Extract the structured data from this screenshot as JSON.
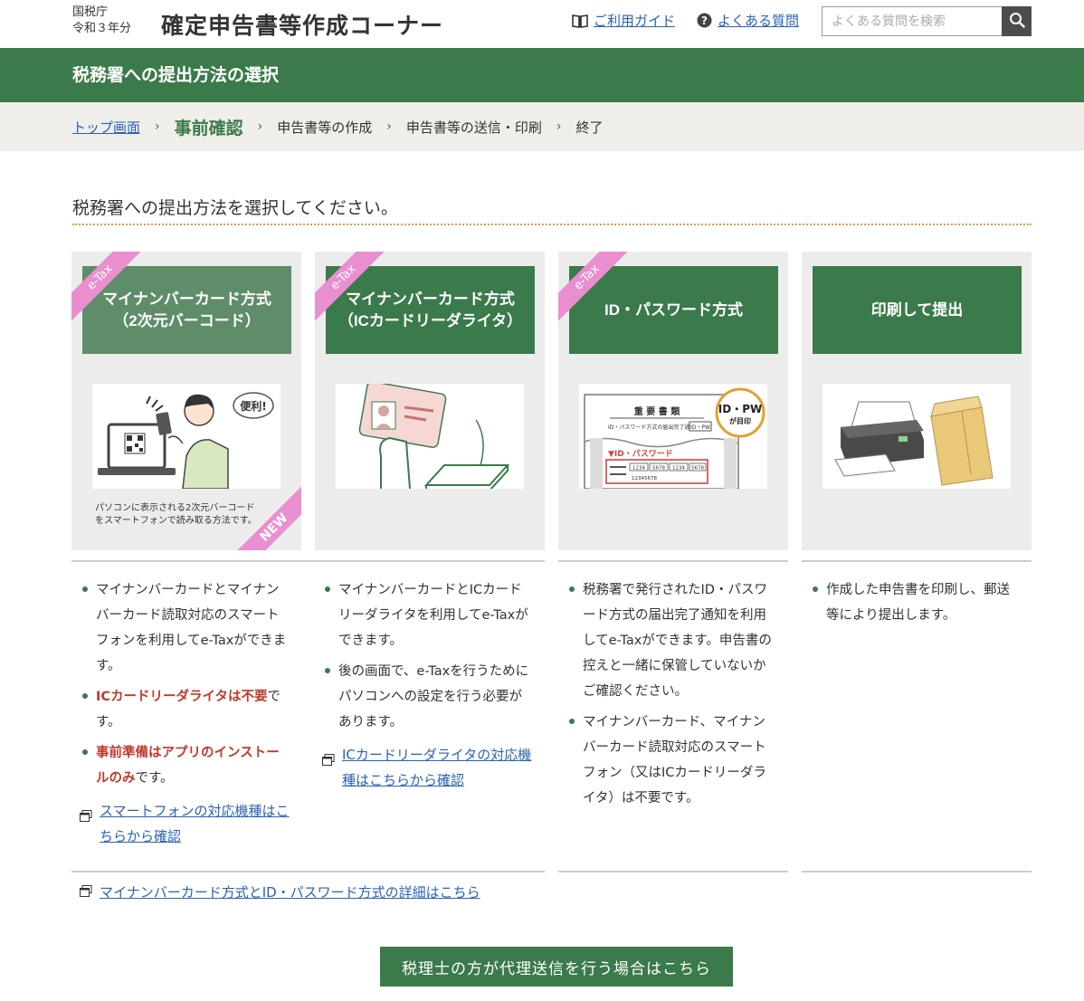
{
  "header": {
    "agency": "国税庁",
    "year": "令和３年分",
    "site_title": "確定申告書等作成コーナー",
    "guide_link": "ご利用ガイド",
    "faq_link": "よくある質問",
    "search_placeholder": "よくある質問を検索"
  },
  "page_title": "税務署への提出方法の選択",
  "breadcrumb": {
    "top": "トップ画面",
    "current": "事前確認",
    "step3": "申告書等の作成",
    "step4": "申告書等の送信・印刷",
    "step5": "終了",
    "separator": "›"
  },
  "instruction": "税務署への提出方法を選択してください。",
  "cards": [
    {
      "tag": "e-Tax",
      "line1": "マイナンバーカード方式",
      "line2": "（2次元バーコード）",
      "bubble": "便利!",
      "caption_line1": "パソコンに表示される2次元バーコード",
      "caption_line2": "をスマートフォンで読み取る方法です。",
      "new_tag": "NEW",
      "bullet1": "マイナンバーカードとマイナンバーカード読取対応のスマートフォンを利用してe-Taxができます。",
      "bullet2_red": "ICカードリーダライタは不要",
      "bullet2_rest": "です。",
      "bullet3_red": "事前準備はアプリのインストールのみ",
      "bullet3_rest": "です。",
      "link": "スマートフォンの対応機種はこちらから確認"
    },
    {
      "tag": "e-Tax",
      "line1": "マイナンバーカード方式",
      "line2": "（ICカードリーダライタ）",
      "bullet1": "マイナンバーカードとICカードリーダライタを利用してe-Taxができます。",
      "bullet2": "後の画面で、e-Taxを行うためにパソコンへの設定を行う必要があります。",
      "link": "ICカードリーダライタの対応機種はこちらから確認"
    },
    {
      "tag": "e-Tax",
      "line1": "ID・パスワード方式",
      "doc_title": "重 要 書 類",
      "doc_sub": "ID・パスワード方式の届出完了通知",
      "doc_box": "ID・PW",
      "stamp1": "ID・PW",
      "stamp2": "が目印",
      "doc_label": "▼ID・パスワード",
      "doc_nums": [
        "1234",
        "5678",
        "1234",
        "5678"
      ],
      "doc_id": "12345678",
      "bullet1": "税務署で発行されたID・パスワード方式の届出完了通知を利用してe-Taxができます。申告書の控えと一緒に保管していないかご確認ください。",
      "bullet2": "マイナンバーカード、マイナンバーカード読取対応のスマートフォン（又はICカードリーダライタ）は不要です。"
    },
    {
      "line1": "印刷して提出",
      "bullet1": "作成した申告書を印刷し、郵送等により提出します。"
    }
  ],
  "detail_link": "マイナンバーカード方式とID・パスワード方式の詳細はこちら",
  "agent_button": "税理士の方が代理送信を行う場合はこちら"
}
